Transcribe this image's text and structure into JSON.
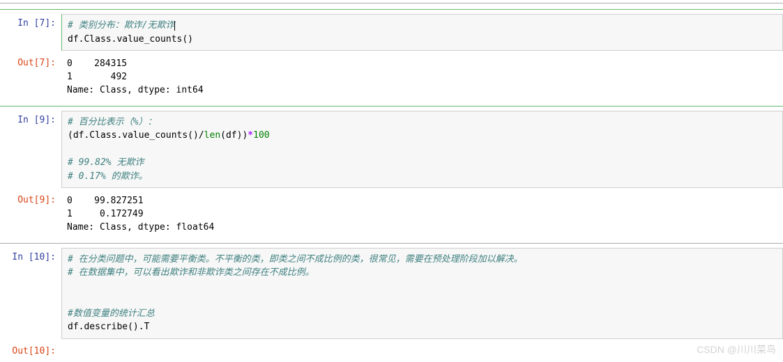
{
  "cells": [
    {
      "in_prompt": "In  [7]:",
      "out_prompt": "Out[7]:",
      "code": {
        "comment1": "# 类别分布：欺诈/无欺诈",
        "line2": "df.Class.value_counts()"
      },
      "output": "0    284315\n1       492\nName: Class, dtype: int64"
    },
    {
      "in_prompt": "In  [9]:",
      "out_prompt": "Out[9]:",
      "code": {
        "comment1": "# 百分比表示（%）：",
        "line2_pre": "(df.Class.value_counts()/",
        "line2_builtin": "len",
        "line2_mid": "(df))",
        "line2_op": "*",
        "line2_num": "100",
        "comment3": "# 99.82% 无欺诈",
        "comment4": "# 0.17% 的欺诈。"
      },
      "output": "0    99.827251\n1     0.172749\nName: Class, dtype: float64"
    },
    {
      "in_prompt": "In [10]:",
      "out_prompt": "Out[10]:",
      "code": {
        "comment1": "# 在分类问题中，可能需要平衡类。不平衡的类，即类之间不成比例的类，很常见，需要在预处理阶段加以解决。",
        "comment2": "# 在数据集中，可以看出欺诈和非欺诈类之间存在不成比例。",
        "comment3": "#数值变量的统计汇总",
        "line4": "df.describe().T"
      },
      "output": ""
    }
  ],
  "watermark": "CSDN @川川菜鸟"
}
